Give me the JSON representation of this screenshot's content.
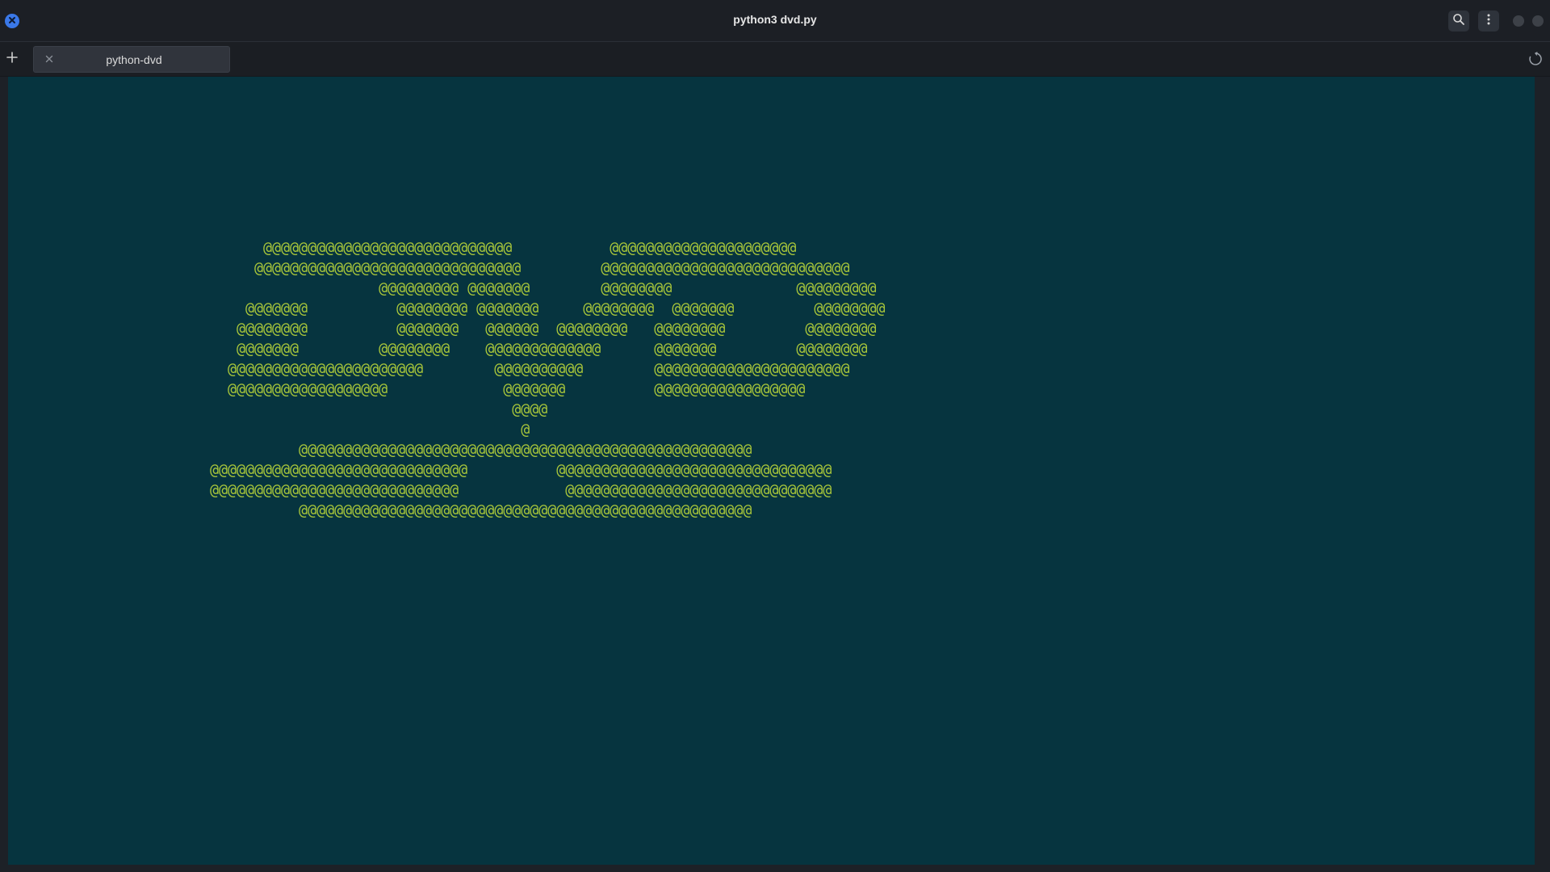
{
  "window": {
    "title": "python3 dvd.py"
  },
  "tabbar": {
    "tabs": [
      {
        "label": "python-dvd",
        "active": true
      }
    ]
  },
  "icons": {
    "close": "close-icon",
    "search": "search-icon",
    "menu": "kebab-menu-icon",
    "new_tab": "plus-icon",
    "tab_close": "close-icon",
    "activity": "activity-spinner-icon"
  },
  "colors": {
    "terminal_background": "#06343f",
    "ascii_foreground": "#a8c63a",
    "accent": "#3a78e8"
  },
  "terminal": {
    "lines": [
      "",
      "",
      "",
      "",
      "",
      "",
      "",
      "",
      "      @@@@@@@@@@@@@@@@@@@@@@@@@@@@           @@@@@@@@@@@@@@@@@@@@@",
      "     @@@@@@@@@@@@@@@@@@@@@@@@@@@@@@         @@@@@@@@@@@@@@@@@@@@@@@@@@@@",
      "                   @@@@@@@@@ @@@@@@@        @@@@@@@@              @@@@@@@@@",
      "    @@@@@@@          @@@@@@@@ @@@@@@@     @@@@@@@@  @@@@@@@         @@@@@@@@",
      "   @@@@@@@@          @@@@@@@   @@@@@@  @@@@@@@@   @@@@@@@@         @@@@@@@@",
      "   @@@@@@@         @@@@@@@@    @@@@@@@@@@@@@      @@@@@@@         @@@@@@@@",
      "  @@@@@@@@@@@@@@@@@@@@@@        @@@@@@@@@@        @@@@@@@@@@@@@@@@@@@@@@",
      "  @@@@@@@@@@@@@@@@@@             @@@@@@@          @@@@@@@@@@@@@@@@@",
      "                                  @@@@",
      "                                   @",
      "          @@@@@@@@@@@@@@@@@@@@@@@@@@@@@@@@@@@@@@@@@@@@@@@@@@@",
      "@@@@@@@@@@@@@@@@@@@@@@@@@@@@@          @@@@@@@@@@@@@@@@@@@@@@@@@@@@@@@",
      "@@@@@@@@@@@@@@@@@@@@@@@@@@@@            @@@@@@@@@@@@@@@@@@@@@@@@@@@@@@",
      "          @@@@@@@@@@@@@@@@@@@@@@@@@@@@@@@@@@@@@@@@@@@@@@@@@@@"
    ]
  }
}
